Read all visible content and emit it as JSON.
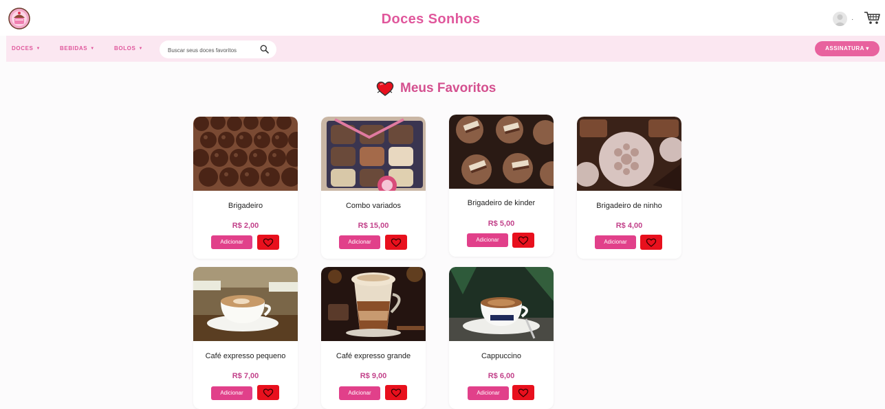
{
  "header": {
    "brand": "Doces Sonhos",
    "icons": {
      "logo": "cupcake-logo",
      "user": "user-avatar-icon",
      "cart": "cart-icon"
    }
  },
  "nav": {
    "items": [
      {
        "label": "DOCES"
      },
      {
        "label": "BEBIDAS"
      },
      {
        "label": "BOLOS"
      }
    ],
    "search": {
      "placeholder": "Buscar seus doces favoritos",
      "value": ""
    },
    "subscription_label": "ASSINATURA ▾"
  },
  "page": {
    "title": "Meus Favoritos",
    "title_icon": "heart-icon"
  },
  "products": [
    {
      "name": "Brigadeiro",
      "price": "R$ 2,00",
      "image": "brigadeiro-photo"
    },
    {
      "name": "Combo variados",
      "price": "R$ 15,00",
      "image": "combo-box-photo"
    },
    {
      "name": "Brigadeiro de kinder",
      "price": "R$ 5,00",
      "image": "kinder-brigadeiro-photo"
    },
    {
      "name": "Brigadeiro de ninho",
      "price": "R$ 4,00",
      "image": "ninho-brigadeiro-photo"
    },
    {
      "name": "Café expresso pequeno",
      "price": "R$ 7,00",
      "image": "espresso-small-photo"
    },
    {
      "name": "Café expresso grande",
      "price": "R$ 9,00",
      "image": "espresso-large-photo"
    },
    {
      "name": "Cappuccino",
      "price": "R$ 6,00",
      "image": "cappuccino-photo"
    }
  ],
  "buttons": {
    "add_label": "Adicionar",
    "favorite_icon": "heart-icon"
  },
  "colors": {
    "brand_pink": "#e0579c",
    "nav_bg": "#fbe7f1",
    "favorite_red": "#e8101d",
    "add_pink": "#e1408a"
  }
}
